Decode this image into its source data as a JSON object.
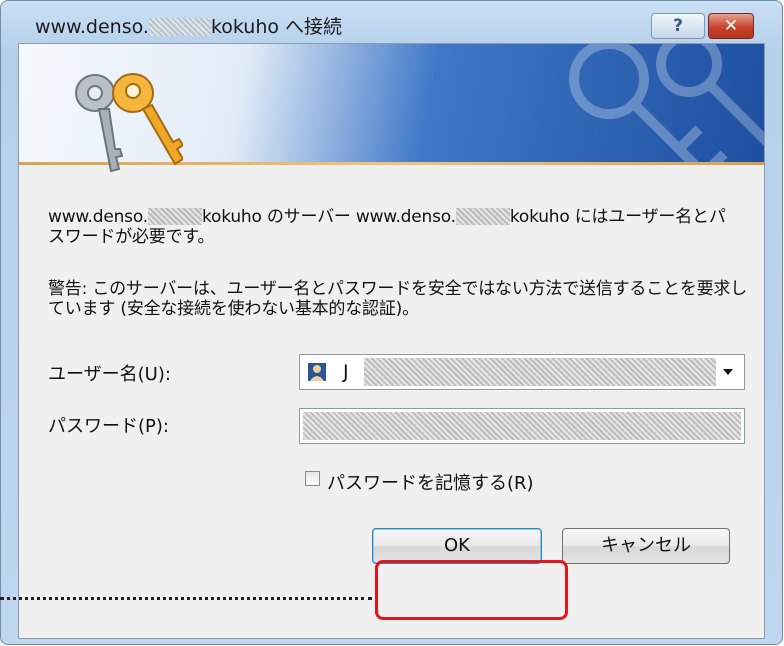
{
  "window": {
    "title_prefix": "www.denso.",
    "title_suffix": "kokuho へ接続",
    "help_label": "?",
    "close_label": "✕"
  },
  "icons": {
    "banner": "keys-icon",
    "user_combo": "user-account-icon"
  },
  "message": {
    "line1_a": "www.denso.",
    "line1_b": "kokuho のサーバー www.denso.",
    "line1_c": "kokuho にはユーザー名とパスワードが必要です。",
    "warning": "警告: このサーバーは、ユーザー名とパスワードを安全ではない方法で送信することを要求しています (安全な接続を使わない基本的な認証)。"
  },
  "form": {
    "username_label": "ユーザー名(U):",
    "username_value": "J",
    "password_label": "パスワード(P):",
    "remember_label": "パスワードを記憶する(R)",
    "remember_checked": false
  },
  "buttons": {
    "ok": "OK",
    "cancel": "キャンセル"
  },
  "colors": {
    "highlight": "#e3161e",
    "close_button": "#c8442f"
  }
}
